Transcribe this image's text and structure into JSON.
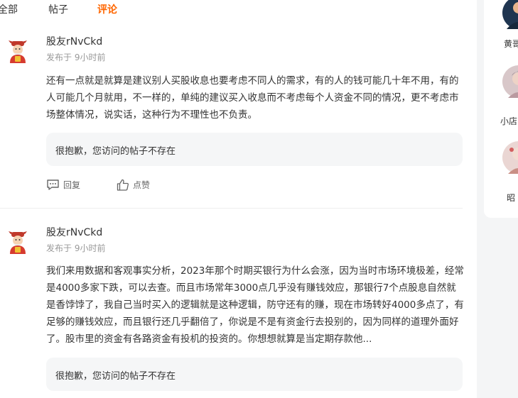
{
  "tabs": [
    {
      "label": "全部"
    },
    {
      "label": "帖子"
    },
    {
      "label": "评论",
      "active": true
    }
  ],
  "comments": [
    {
      "author": "股友rNvCkd",
      "time": "发布于 9小时前",
      "text": "还有一点就是就算是建议别人买股收息也要考虑不同人的需求，有的人的钱可能几十年不用，有的人可能几个月就用，不一样的，单纯的建议买入收息而不考虑每个人资金不同的情况，更不考虑市场整体情况，说实话，这种行为不理性也不负责。",
      "quote": "很抱歉，您访问的帖子不存在",
      "reply_label": "回复",
      "like_label": "点赞"
    },
    {
      "author": "股友rNvCkd",
      "time": "发布于 9小时前",
      "text": "我们来用数据和客观事实分析，2023年那个时期买银行为什么会涨，因为当时市场环境极差，经常是4000多家下跌，可以去查。而且市场常年3000点几乎没有赚钱效应，那银行7个点股息自然就是香饽饽了，我自己当时买入的逻辑就是这种逻辑，防守还有的赚，现在市场转好4000多点了，有足够的赚钱效应，而且银行还几乎翻倍了，你说是不是有资金行去投别的，因为同样的道理外面好了。股市里的资金有各路资金有投机的投资的。你想想就算是当定期存款他...",
      "quote": "很抱歉，您访问的帖子不存在"
    }
  ],
  "sidebar": {
    "users": [
      {
        "name": "黄哥"
      },
      {
        "name": "小店"
      },
      {
        "name": "昭"
      }
    ]
  },
  "colors": {
    "accent": "#ff6600",
    "quote_bg": "#f5f6f7",
    "muted": "#999999"
  }
}
